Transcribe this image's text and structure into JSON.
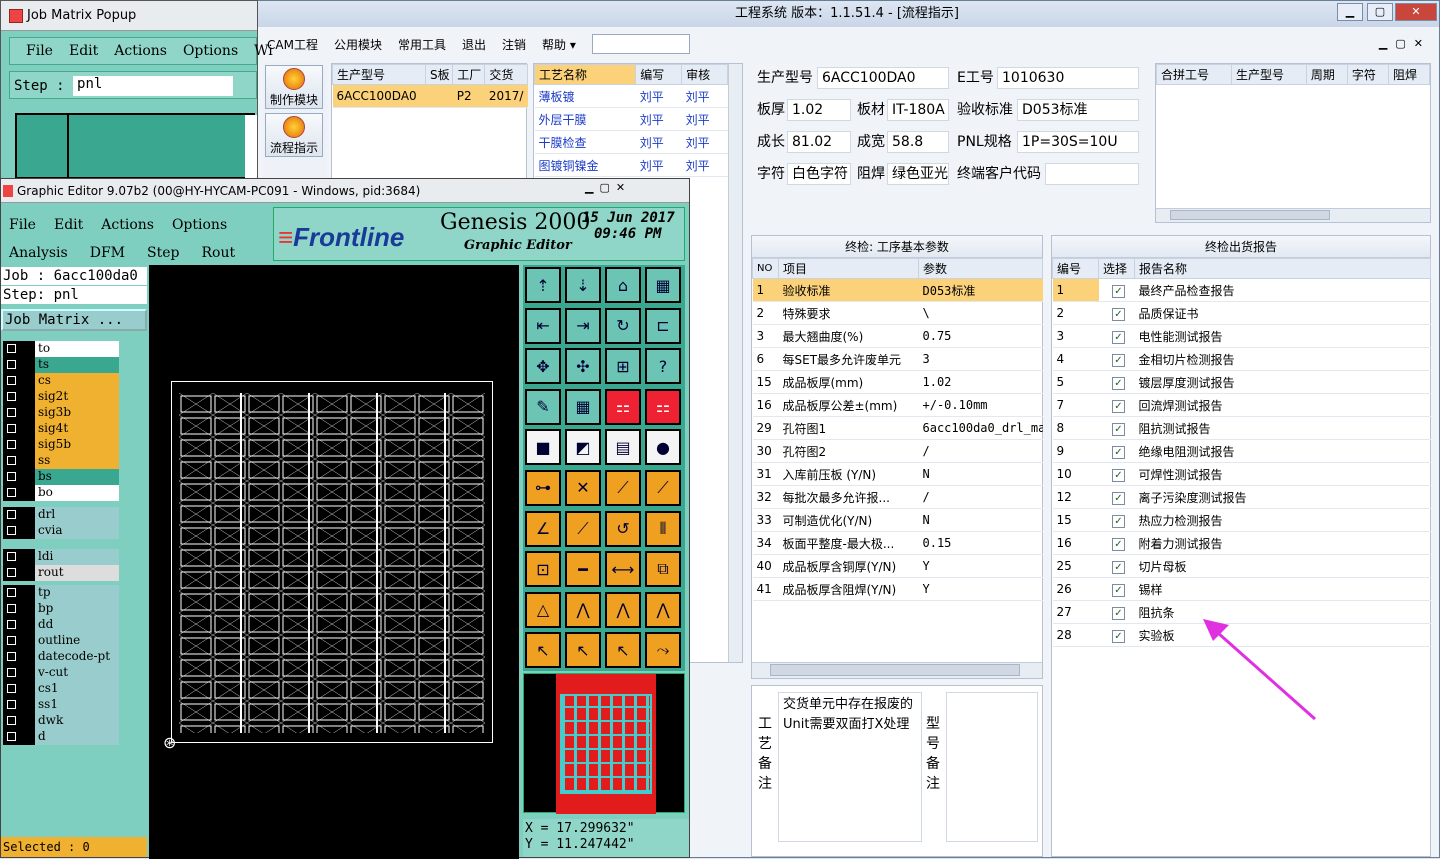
{
  "job_matrix": {
    "title": "Job Matrix Popup",
    "menu": [
      "File",
      "Edit",
      "Actions",
      "Options",
      "Wi"
    ],
    "step_label": "Step :",
    "step_value": "pnl"
  },
  "main": {
    "title": "工程系统  版本：1.1.51.4 - [流程指示]",
    "menu": [
      "CAM工程",
      "公用模块",
      "常用工具",
      "退出",
      "注销",
      "帮助"
    ],
    "side_buttons": [
      "制作模块",
      "流程指示"
    ],
    "orders": {
      "headers": [
        "生产型号",
        "S板",
        "工厂",
        "交货"
      ],
      "rows": [
        [
          "6ACC100DA0",
          "",
          "P2",
          "2017/"
        ]
      ]
    },
    "process": {
      "headers": [
        "工艺名称",
        "编写",
        "审核"
      ],
      "rows": [
        [
          "薄板镀",
          "刘平",
          "刘平"
        ],
        [
          "外层干膜",
          "刘平",
          "刘平"
        ],
        [
          "干膜检查",
          "刘平",
          "刘平"
        ],
        [
          "图镀铜镍金",
          "刘平",
          "刘平"
        ]
      ]
    },
    "info": {
      "model_label": "生产型号",
      "model": "6ACC100DA0",
      "eno_label": "E工号",
      "eno": "1010630",
      "thick_label": "板厚",
      "thick": "1.02",
      "mat_label": "板材",
      "mat": "IT-180A",
      "std_label": "验收标准",
      "std": "D053标准",
      "grow_label": "成长",
      "grow": "81.02",
      "wid_label": "成宽",
      "wid": "58.8",
      "pnl_label": "PNL规格",
      "pnl": "1P=30S=10U",
      "char_label": "字符",
      "char": "白色字符",
      "solder_label": "阻焊",
      "solder": "绿色亚光",
      "cust_label": "终端客户代码",
      "cust": ""
    },
    "merge": {
      "headers": [
        "合拼工号",
        "生产型号",
        "周期",
        "字符",
        "阻焊"
      ]
    },
    "params": {
      "title": "终检: 工序基本参数",
      "headers": [
        "NO",
        "项目",
        "参数"
      ],
      "rows": [
        [
          "1",
          "验收标准",
          "D053标准"
        ],
        [
          "2",
          "特殊要求",
          "\\"
        ],
        [
          "3",
          "最大翘曲度(%)",
          "0.75"
        ],
        [
          "6",
          "每SET最多允许废单元",
          "3"
        ],
        [
          "15",
          "成品板厚(mm)",
          "1.02"
        ],
        [
          "16",
          "成品板厚公差±(mm)",
          "+/-0.10mm"
        ],
        [
          "29",
          "孔符图1",
          "6acc100da0_drl_ma"
        ],
        [
          "30",
          "孔符图2",
          "/"
        ],
        [
          "31",
          "入库前压板 (Y/N)",
          "N"
        ],
        [
          "32",
          "每批次最多允许报...",
          "/"
        ],
        [
          "33",
          "可制造优化(Y/N)",
          "N"
        ],
        [
          "34",
          "板面平整度-最大极...",
          "0.15"
        ],
        [
          "40",
          "成品板厚含铜厚(Y/N)",
          "Y"
        ],
        [
          "41",
          "成品板厚含阻焊(Y/N)",
          "Y"
        ]
      ]
    },
    "reports": {
      "title": "终检出货报告",
      "headers": [
        "编号",
        "选择",
        "报告名称"
      ],
      "rows": [
        [
          "1",
          "最终产品检查报告"
        ],
        [
          "2",
          "品质保证书"
        ],
        [
          "3",
          "电性能测试报告"
        ],
        [
          "4",
          "金相切片检测报告"
        ],
        [
          "5",
          "镀层厚度测试报告"
        ],
        [
          "7",
          "回流焊测试报告"
        ],
        [
          "8",
          "阻抗测试报告"
        ],
        [
          "9",
          "绝缘电阻测试报告"
        ],
        [
          "10",
          "可焊性测试报告"
        ],
        [
          "12",
          "离子污染度测试报告"
        ],
        [
          "15",
          "热应力检测报告"
        ],
        [
          "16",
          "附着力测试报告"
        ],
        [
          "25",
          "切片母板"
        ],
        [
          "26",
          "锡样"
        ],
        [
          "27",
          "阻抗条"
        ],
        [
          "28",
          "实验板"
        ]
      ]
    },
    "remarks": {
      "craft_label": "工艺备注",
      "craft_text": "交货单元中存在报废的Unit需要双面打X处理",
      "model_label": "型号备注"
    },
    "colors": {
      "arrow": "#e030e0"
    }
  },
  "ge": {
    "title": "Graphic Editor 9.07b2 (00@HY-HYCAM-PC091 - Windows, pid:3684)",
    "menu1": [
      "File",
      "Edit",
      "Actions",
      "Options"
    ],
    "menu2": [
      "Analysis",
      "DFM",
      "Step",
      "Rout"
    ],
    "brand": "Frontline",
    "product": "Genesis 2000",
    "subtitle": "Graphic Editor",
    "date": "15 Jun 2017",
    "time": "09:46 PM",
    "job": "Job  : 6acc100da0",
    "step": "Step: pnl",
    "job_matrix_btn": "Job Matrix ...",
    "layers_a": [
      {
        "n": "to",
        "c": "#ffffff"
      },
      {
        "n": "ts",
        "c": "#3aa890"
      },
      {
        "n": "cs",
        "c": "#f0b030"
      },
      {
        "n": "sig2t",
        "c": "#f0b030"
      },
      {
        "n": "sig3b",
        "c": "#f0b030"
      },
      {
        "n": "sig4t",
        "c": "#f0b030"
      },
      {
        "n": "sig5b",
        "c": "#f0b030"
      },
      {
        "n": "ss",
        "c": "#f0b030"
      },
      {
        "n": "bs",
        "c": "#3aa890"
      },
      {
        "n": "bo",
        "c": "#ffffff"
      }
    ],
    "layers_b": [
      {
        "n": "drl",
        "c": "#9cc"
      },
      {
        "n": "cvia",
        "c": "#9cc"
      }
    ],
    "layers_c": [
      {
        "n": "ldi",
        "c": "#9cc"
      },
      {
        "n": "rout",
        "c": "#ddd"
      }
    ],
    "layers_d": [
      {
        "n": "tp",
        "c": "#9cc"
      },
      {
        "n": "bp",
        "c": "#9cc"
      },
      {
        "n": "dd",
        "c": "#9cc"
      },
      {
        "n": "outline",
        "c": "#9cc"
      },
      {
        "n": "datecode-pt",
        "c": "#9cc"
      },
      {
        "n": "v-cut",
        "c": "#9cc"
      },
      {
        "n": "cs1",
        "c": "#9cc"
      },
      {
        "n": "ss1",
        "c": "#9cc"
      },
      {
        "n": "dwk",
        "c": "#9cc"
      },
      {
        "n": "d",
        "c": "#9cc"
      }
    ],
    "selected": "Selected : 0",
    "x_coord": "X  =  17.299632\"",
    "y_coord": "Y  =  11.247442\""
  }
}
